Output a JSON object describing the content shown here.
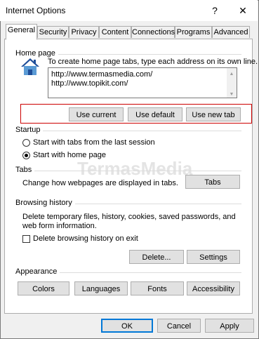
{
  "window": {
    "title": "Internet Options",
    "help_glyph": "?",
    "close_glyph": "✕"
  },
  "tabs": [
    {
      "label": "General"
    },
    {
      "label": "Security"
    },
    {
      "label": "Privacy"
    },
    {
      "label": "Content"
    },
    {
      "label": "Connections"
    },
    {
      "label": "Programs"
    },
    {
      "label": "Advanced"
    }
  ],
  "home_page": {
    "group_label": "Home page",
    "instructions": "To create home page tabs, type each address on its own line.",
    "addresses": [
      "http://www.termasmedia.com/",
      "http://www.topikit.com/"
    ],
    "buttons": {
      "use_current": "Use current",
      "use_default": "Use default",
      "use_new_tab": "Use new tab"
    }
  },
  "startup": {
    "group_label": "Startup",
    "option_last_session": "Start with tabs from the last session",
    "option_home_page": "Start with home page",
    "selected": "home_page"
  },
  "tabs_section": {
    "group_label": "Tabs",
    "description": "Change how webpages are displayed in tabs.",
    "button": "Tabs"
  },
  "browsing_history": {
    "group_label": "Browsing history",
    "description": "Delete temporary files, history, cookies, saved passwords, and web form information.",
    "checkbox_label": "Delete browsing history on exit",
    "checkbox_checked": false,
    "delete_button": "Delete...",
    "settings_button": "Settings"
  },
  "appearance": {
    "group_label": "Appearance",
    "buttons": {
      "colors": "Colors",
      "languages": "Languages",
      "fonts": "Fonts",
      "accessibility": "Accessibility"
    }
  },
  "footer": {
    "ok": "OK",
    "cancel": "Cancel",
    "apply": "Apply"
  },
  "watermark": "TermasMedia",
  "colors": {
    "highlight_box": "#cc0000",
    "accent": "#0078d7",
    "house_roof": "#1f4e99",
    "house_wall": "#5b9bd5"
  }
}
